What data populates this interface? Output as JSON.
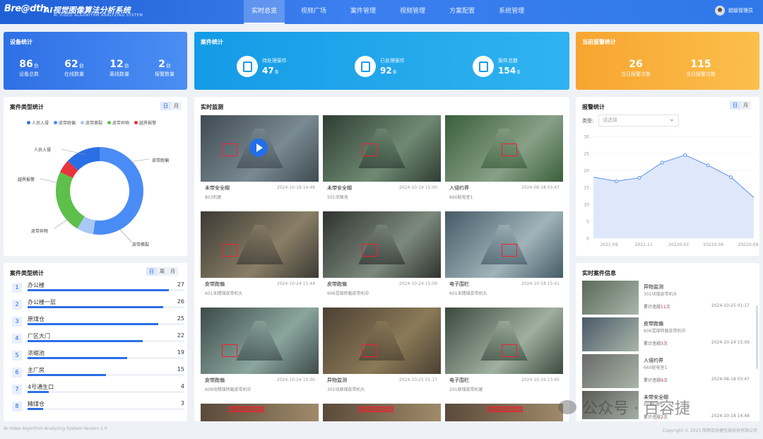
{
  "brand": {
    "logo": "Bre@dth",
    "title": "AI视觉图像算法分析系统",
    "subtitle": "AI VIDEO ALGORITHM ANALYZING SYSTEM"
  },
  "nav": [
    {
      "label": "实时总览",
      "active": true
    },
    {
      "label": "视频广场"
    },
    {
      "label": "案件管理"
    },
    {
      "label": "视频管理"
    },
    {
      "label": "方案配置"
    },
    {
      "label": "系统管理"
    }
  ],
  "user": {
    "name": "超级管理员"
  },
  "device_stats": {
    "title": "设备统计",
    "items": [
      {
        "value": "86",
        "unit": "台",
        "label": "设备总数"
      },
      {
        "value": "62",
        "unit": "台",
        "label": "在线数量"
      },
      {
        "value": "12",
        "unit": "台",
        "label": "离线数量"
      },
      {
        "value": "2",
        "unit": "台",
        "label": "报警数量"
      }
    ]
  },
  "case_stats": {
    "title": "案件统计",
    "items": [
      {
        "label": "待处理案件",
        "value": "47",
        "unit": "条"
      },
      {
        "label": "已处理案件",
        "value": "92",
        "unit": "条"
      },
      {
        "label": "案件总数",
        "value": "154",
        "unit": "条"
      }
    ]
  },
  "alarm_current": {
    "title": "当前报警统计",
    "items": [
      {
        "value": "26",
        "label": "当日报警次数"
      },
      {
        "value": "115",
        "label": "当月报警次数"
      }
    ]
  },
  "case_type_pie": {
    "title": "案件类型统计",
    "toggle": [
      "日",
      "月"
    ],
    "legend": [
      {
        "name": "人员入侵",
        "color": "#2b6fe6"
      },
      {
        "name": "皮带跑偏",
        "color": "#4a8cf5"
      },
      {
        "name": "皮带撕裂",
        "color": "#a9c7f7"
      },
      {
        "name": "皮带异物",
        "color": "#5cc04a"
      },
      {
        "name": "越界报警",
        "color": "#e8323c"
      }
    ],
    "labels": [
      "人员入侵",
      "皮带跑偏",
      "越界报警",
      "皮带异物",
      "皮带撕裂"
    ]
  },
  "case_rank": {
    "title": "案件类型统计",
    "toggle": [
      "日",
      "周",
      "月"
    ],
    "rows": [
      {
        "no": "1",
        "name": "办公楼",
        "value": "27"
      },
      {
        "no": "2",
        "name": "办公楼一层",
        "value": "26"
      },
      {
        "no": "3",
        "name": "原煤仓",
        "value": "25"
      },
      {
        "no": "4",
        "name": "厂区大门",
        "value": "22"
      },
      {
        "no": "5",
        "name": "浓缩池",
        "value": "19"
      },
      {
        "no": "6",
        "name": "主厂房",
        "value": "15"
      },
      {
        "no": "7",
        "name": "4号通生口",
        "value": "4"
      },
      {
        "no": "8",
        "name": "精煤仓",
        "value": "3"
      }
    ]
  },
  "monitor": {
    "title": "实时监测",
    "videos": [
      {
        "title": "未带安全帽",
        "date": "2024-10-18 14:48",
        "loc": "803机尾"
      },
      {
        "title": "未带安全帽",
        "date": "2024-10-19 15:00",
        "loc": "501浓缩池"
      },
      {
        "title": "入侵约界",
        "date": "2024-08-18 03:47",
        "loc": "660配电室1"
      },
      {
        "title": "皮带跑偏",
        "date": "2024-10-24 15:44",
        "loc": "601末精煤皮带机头"
      },
      {
        "title": "皮带跑偏",
        "date": "2024-10-24 15:09",
        "loc": "606混煤转载皮带机中"
      },
      {
        "title": "电子围栏",
        "date": "2024-10-18 15:41",
        "loc": "601末精煤皮带机头"
      },
      {
        "title": "皮带跑偏",
        "date": "2024-10-24 15:00",
        "loc": "609块精煤转载皮带机中"
      },
      {
        "title": "异物监测",
        "date": "2024-10-25 01:17",
        "loc": "301块原煤皮带机头"
      },
      {
        "title": "电子围栏",
        "date": "2024-10-19 13:45",
        "loc": "201原煤皮带机尾"
      }
    ]
  },
  "alarm_chart": {
    "title": "报警统计",
    "toggle": [
      "日",
      "月"
    ],
    "filter_label": "类型:",
    "filter_placeholder": "请选择"
  },
  "chart_data": {
    "type": "area",
    "title": "",
    "categories": [
      "2021-09",
      "2021-11",
      "20220-03",
      "20220-06",
      "20220-09"
    ],
    "x": [
      0,
      1,
      2,
      3,
      4,
      5,
      6,
      7
    ],
    "values": [
      18,
      16.8,
      17.8,
      22.3,
      24.5,
      21.5,
      18,
      12
    ],
    "ylim": [
      0,
      30
    ],
    "yticks": [
      "0",
      "5",
      "10",
      "15",
      "20",
      "25",
      "30"
    ],
    "grid": true,
    "color": "#5b8ff0"
  },
  "realtime": {
    "title": "实时案件信息",
    "items": [
      {
        "title": "异物监测",
        "loc": "301块煤皮带机头",
        "count_prefix": "累计违规",
        "count": "11",
        "count_suffix": "次",
        "date": "2024-10-25 01:17"
      },
      {
        "title": "皮带跑偏",
        "loc": "606混煤转载皮带机中",
        "count_prefix": "累计违规",
        "count": "3",
        "count_suffix": "次",
        "date": "2024-10-24 15:09"
      },
      {
        "title": "入侵约界",
        "loc": "660配电室1",
        "count_prefix": "累计违规",
        "count": "9",
        "count_suffix": "次",
        "date": "2024-08-18 03:47"
      },
      {
        "title": "未带安全帽",
        "loc": "803机尾",
        "count_prefix": "累计违规",
        "count": "2",
        "count_suffix": "次",
        "date": "2024-10-18 14:48"
      }
    ]
  },
  "footer": {
    "left": "AI Video Algorithm Analyzing System Version 2.0",
    "right": "Copyright © 2023 陕西百容捷信息科技有限公司"
  },
  "watermark": {
    "text": "公众号 · 百容捷"
  }
}
